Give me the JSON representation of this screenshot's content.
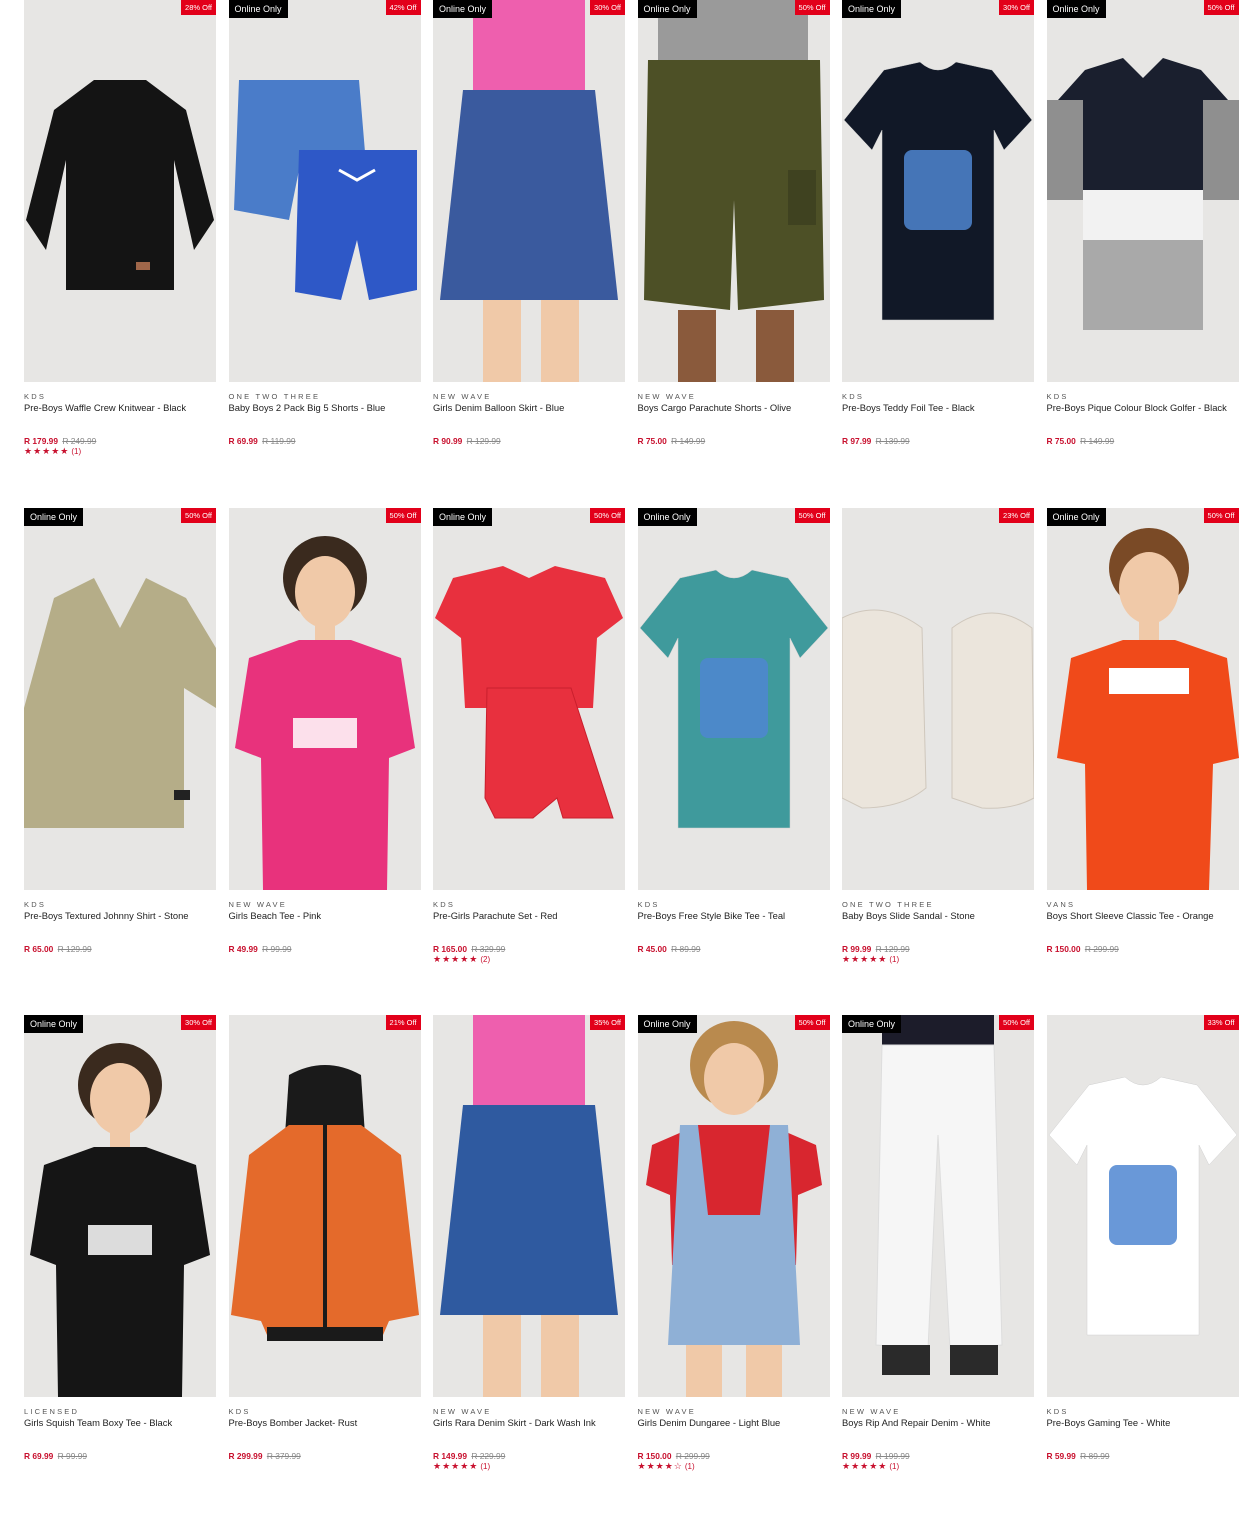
{
  "products": [
    {
      "brand": "KDS",
      "name": "Pre-Boys Waffle Crew Knitwear - Black",
      "price": "R 179.99",
      "was": "R 249.99",
      "online": "",
      "discount": "28% Off",
      "stars": "★★★★★",
      "reviews": "(1)",
      "art": "sweater",
      "color": "#141414",
      "bg": "#e7e6e4"
    },
    {
      "brand": "ONE TWO THREE",
      "name": "Baby Boys 2 Pack Big 5 Shorts - Blue",
      "price": "R 69.99",
      "was": "R 119.99",
      "online": "Online Only",
      "discount": "42% Off",
      "stars": "",
      "reviews": "",
      "art": "shorts2",
      "color": "#2e58c7",
      "bg": "#e7e6e4"
    },
    {
      "brand": "NEW WAVE",
      "name": "Girls Denim Balloon Skirt - Blue",
      "price": "R 90.99",
      "was": "R 129.99",
      "online": "Online Only",
      "discount": "30% Off",
      "stars": "",
      "reviews": "",
      "art": "skirt",
      "color": "#3a5a9e",
      "bg": "#e7e6e4"
    },
    {
      "brand": "NEW WAVE",
      "name": "Boys Cargo Parachute Shorts - Olive",
      "price": "R 75.00",
      "was": "R 149.99",
      "online": "Online Only",
      "discount": "50% Off",
      "stars": "",
      "reviews": "",
      "art": "cargo",
      "color": "#4d5026",
      "bg": "#e7e6e4"
    },
    {
      "brand": "KDS",
      "name": "Pre-Boys Teddy Foil Tee - Black",
      "price": "R 97.99",
      "was": "R 139.99",
      "online": "Online Only",
      "discount": "30% Off",
      "stars": "",
      "reviews": "",
      "art": "tee",
      "color": "#111827",
      "bg": "#e7e6e4"
    },
    {
      "brand": "KDS",
      "name": "Pre-Boys Pique Colour Block Golfer - Black",
      "price": "R 75.00",
      "was": "R 149.99",
      "online": "Online Only",
      "discount": "50% Off",
      "stars": "",
      "reviews": "",
      "art": "golfer",
      "color": "#1a1f2e",
      "bg": "#e7e6e4"
    },
    {
      "brand": "KDS",
      "name": "Pre-Boys Textured Johnny Shirt - Stone",
      "price": "R 65.00",
      "was": "R 129.99",
      "online": "Online Only",
      "discount": "50% Off",
      "stars": "",
      "reviews": "",
      "art": "polo",
      "color": "#b5ad88",
      "bg": "#e7e6e4"
    },
    {
      "brand": "NEW WAVE",
      "name": "Girls Beach Tee - Pink",
      "price": "R 49.99",
      "was": "R 99.99",
      "online": "",
      "discount": "50% Off",
      "stars": "",
      "reviews": "",
      "art": "girltee",
      "color": "#e8327c",
      "bg": "#e7e6e4"
    },
    {
      "brand": "KDS",
      "name": "Pre-Girls Parachute Set - Red",
      "price": "R 165.00",
      "was": "R 329.99",
      "online": "Online Only",
      "discount": "50% Off",
      "stars": "★★★★★",
      "reviews": "(2)",
      "art": "set",
      "color": "#e8303e",
      "bg": "#e7e6e4"
    },
    {
      "brand": "KDS",
      "name": "Pre-Boys Free Style Bike Tee - Teal",
      "price": "R 45.00",
      "was": "R 89.99",
      "online": "Online Only",
      "discount": "50% Off",
      "stars": "",
      "reviews": "",
      "art": "tee",
      "color": "#3f9a9c",
      "bg": "#e7e6e4"
    },
    {
      "brand": "ONE TWO THREE",
      "name": "Baby Boys Slide Sandal - Stone",
      "price": "R 99.99",
      "was": "R 129.99",
      "online": "",
      "discount": "23% Off",
      "stars": "★★★★★",
      "reviews": "(1)",
      "art": "sandal",
      "color": "#ebe5dc",
      "bg": "#e7e6e4"
    },
    {
      "brand": "VANS",
      "name": "Boys Short Sleeve Classic Tee - Orange",
      "price": "R 150.00",
      "was": "R 299.99",
      "online": "Online Only",
      "discount": "50% Off",
      "stars": "",
      "reviews": "",
      "art": "boytee",
      "color": "#f04a1a",
      "bg": "#e7e6e4"
    },
    {
      "brand": "LICENSED",
      "name": "Girls Squish Team Boxy Tee - Black",
      "price": "R 69.99",
      "was": "R 99.99",
      "online": "Online Only",
      "discount": "30% Off",
      "stars": "",
      "reviews": "",
      "art": "girltee",
      "color": "#151515",
      "bg": "#e7e6e4"
    },
    {
      "brand": "KDS",
      "name": "Pre-Boys Bomber Jacket- Rust",
      "price": "R 299.99",
      "was": "R 379.99",
      "online": "",
      "discount": "21% Off",
      "stars": "",
      "reviews": "",
      "art": "jacket",
      "color": "#e46a2b",
      "bg": "#e7e6e4"
    },
    {
      "brand": "NEW WAVE",
      "name": "Girls Rara Denim Skirt - Dark Wash Ink",
      "price": "R 149.99",
      "was": "R 229.99",
      "online": "",
      "discount": "35% Off",
      "stars": "★★★★★",
      "reviews": "(1)",
      "art": "skirt",
      "color": "#2f5aa0",
      "bg": "#e7e6e4"
    },
    {
      "brand": "NEW WAVE",
      "name": "Girls Denim Dungaree - Light Blue",
      "price": "R 150.00",
      "was": "R 299.99",
      "online": "Online Only",
      "discount": "50% Off",
      "stars": "★★★★☆",
      "reviews": "(1)",
      "art": "dungaree",
      "color": "#8fb0d6",
      "bg": "#e7e6e4"
    },
    {
      "brand": "NEW WAVE",
      "name": "Boys Rip And Repair Denim - White",
      "price": "R 99.99",
      "was": "R 199.99",
      "online": "Online Only",
      "discount": "50% Off",
      "stars": "★★★★★",
      "reviews": "(1)",
      "art": "jeans",
      "color": "#f6f6f6",
      "bg": "#e7e6e4"
    },
    {
      "brand": "KDS",
      "name": "Pre-Boys Gaming Tee - White",
      "price": "R 59.99",
      "was": "R 89.99",
      "online": "",
      "discount": "33% Off",
      "stars": "",
      "reviews": "",
      "art": "tee",
      "color": "#ffffff",
      "bg": "#e7e6e4"
    }
  ]
}
